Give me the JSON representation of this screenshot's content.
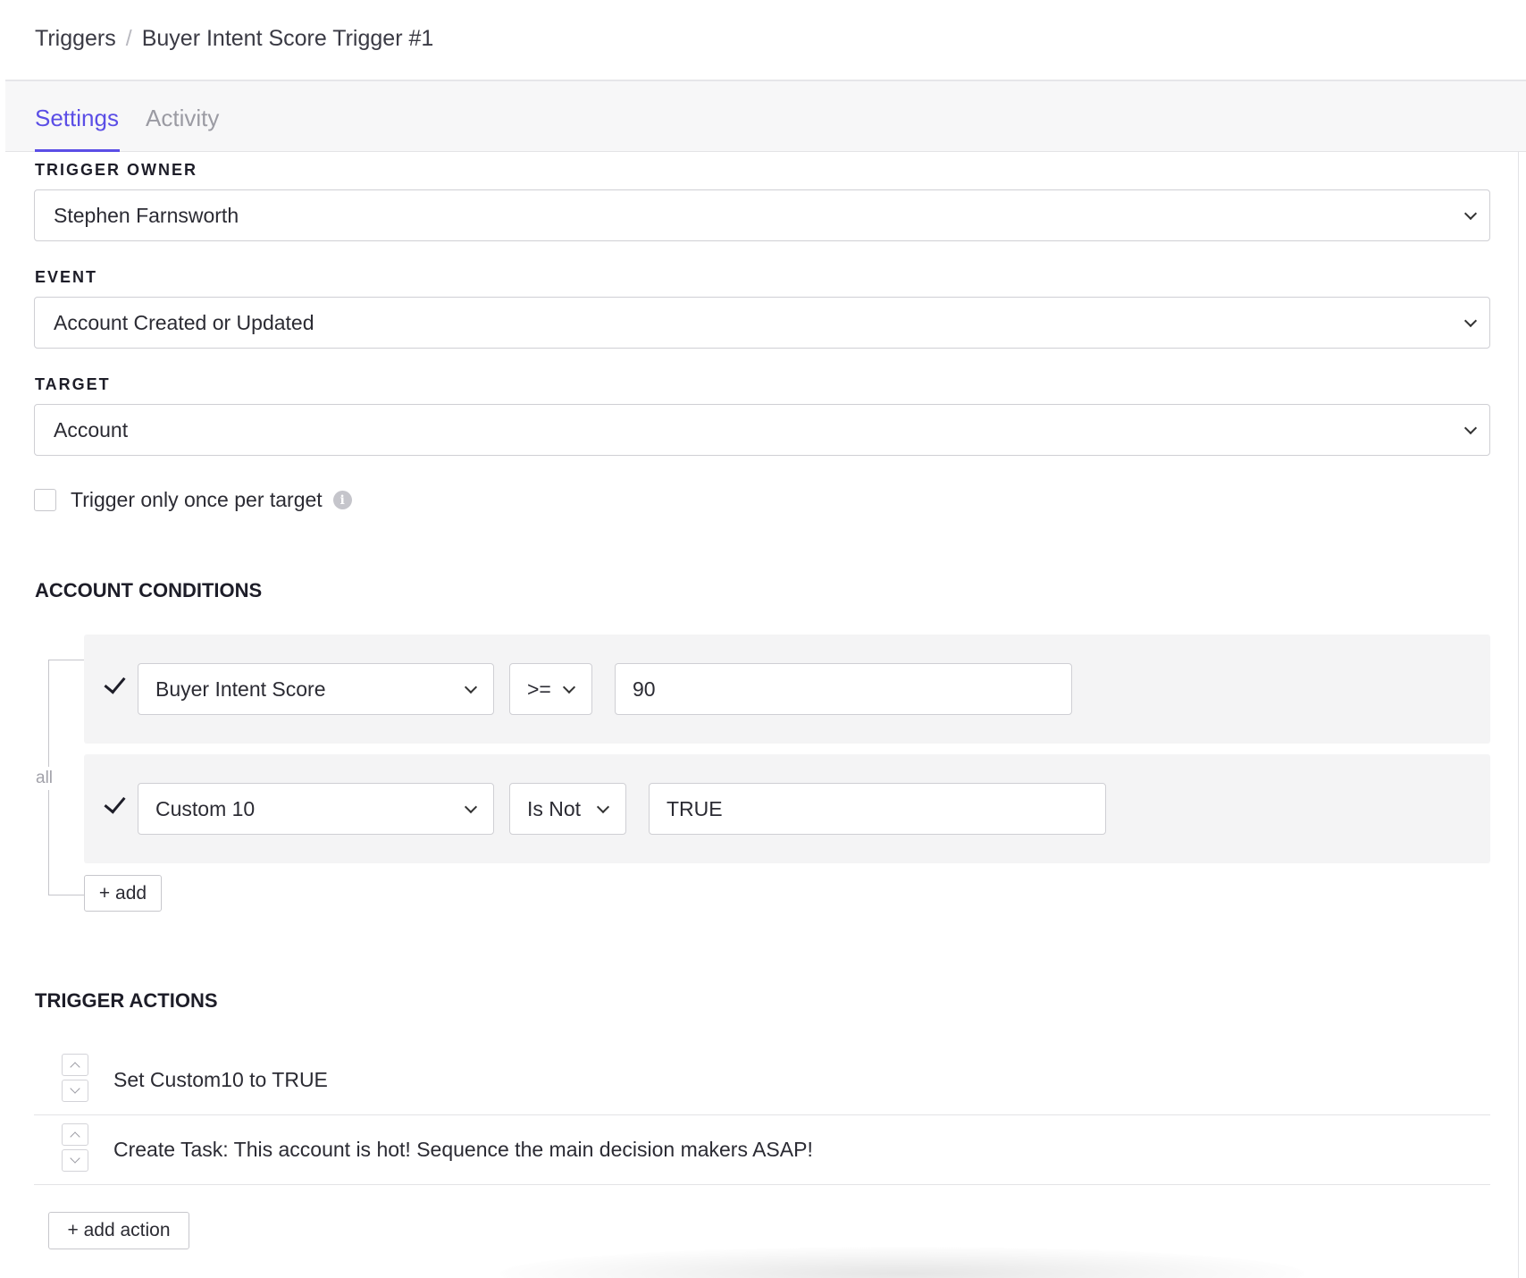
{
  "breadcrumb": {
    "root": "Triggers",
    "separator": "/",
    "current": "Buyer Intent Score Trigger #1"
  },
  "tabs": [
    {
      "label": "Settings",
      "active": true
    },
    {
      "label": "Activity",
      "active": false
    }
  ],
  "colors": {
    "accent": "#5b4ee6",
    "row_background": "#f4f4f5"
  },
  "trigger_owner": {
    "label": "TRIGGER OWNER",
    "value": "Stephen Farnsworth"
  },
  "event": {
    "label": "EVENT",
    "value": "Account Created or Updated"
  },
  "target": {
    "label": "TARGET",
    "value": "Account"
  },
  "trigger_once": {
    "label": "Trigger only once per target",
    "checked": false,
    "info_icon": "info-icon"
  },
  "conditions": {
    "heading": "ACCOUNT CONDITIONS",
    "group_operator": "all",
    "rows": [
      {
        "field": "Buyer Intent Score",
        "operator": ">=",
        "value": "90"
      },
      {
        "field": "Custom 10",
        "operator": "Is Not",
        "value": "TRUE"
      }
    ],
    "add_label": "+ add"
  },
  "actions": {
    "heading": "TRIGGER ACTIONS",
    "items": [
      {
        "text": "Set Custom10 to TRUE"
      },
      {
        "text": "Create Task: This account is hot! Sequence the main decision makers ASAP!"
      }
    ],
    "add_label": "+ add action"
  }
}
